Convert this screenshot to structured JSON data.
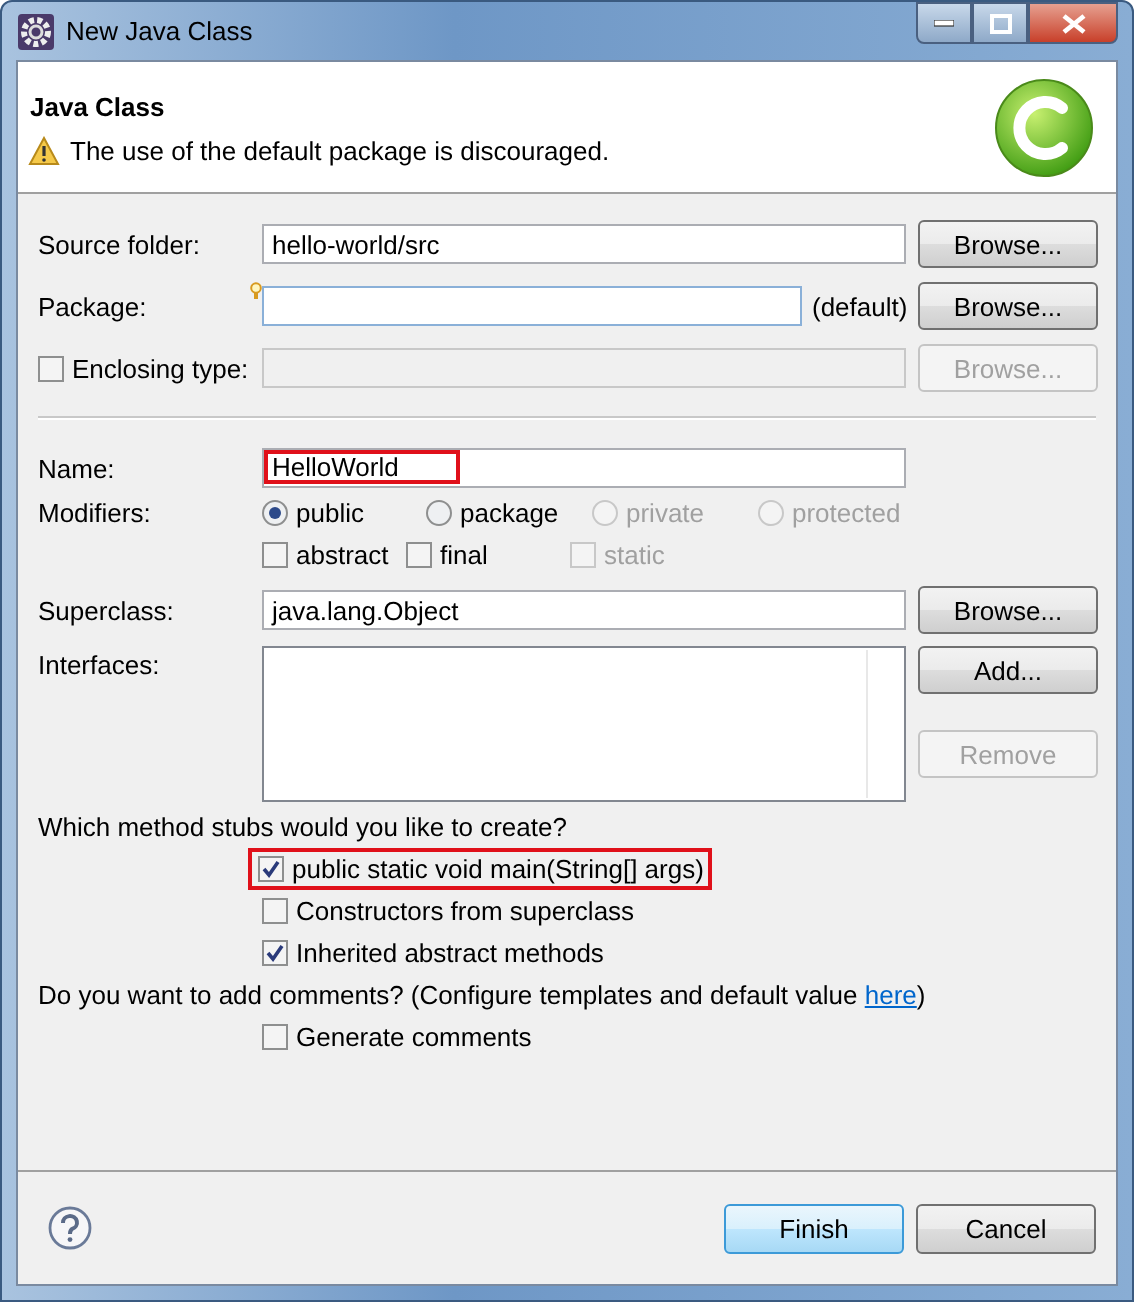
{
  "window": {
    "title": "New Java Class"
  },
  "header": {
    "title": "Java Class",
    "message": "The use of the default package is discouraged."
  },
  "source_folder": {
    "label": "Source folder:",
    "value": "hello-world/src",
    "button": {
      "label": "Browse...",
      "disabled": false
    }
  },
  "package": {
    "label": "Package:",
    "suffix": "(default)",
    "button": {
      "label": "Browse...",
      "disabled": false
    }
  },
  "enclosing_type": {
    "label": "Enclosing type:",
    "checked": false,
    "button": {
      "label": "Browse...",
      "disabled": true
    }
  },
  "name": {
    "label": "Name:",
    "value": "HelloWorld",
    "highlighted": true
  },
  "modifiers": {
    "label": "Modifiers:",
    "visibility": [
      {
        "label": "public",
        "selected": true,
        "disabled": false
      },
      {
        "label": "package",
        "selected": false,
        "disabled": false
      },
      {
        "label": "private",
        "selected": false,
        "disabled": true
      },
      {
        "label": "protected",
        "selected": false,
        "disabled": true
      }
    ],
    "flags": [
      {
        "label": "abstract",
        "checked": false,
        "disabled": false
      },
      {
        "label": "final",
        "checked": false,
        "disabled": false
      },
      {
        "label": "static",
        "checked": false,
        "disabled": true
      }
    ]
  },
  "superclass": {
    "label": "Superclass:",
    "value": "java.lang.Object",
    "button": {
      "label": "Browse...",
      "disabled": false
    }
  },
  "interfaces": {
    "label": "Interfaces:",
    "buttons": [
      {
        "label": "Add...",
        "disabled": false
      },
      {
        "label": "Remove",
        "disabled": true
      }
    ]
  },
  "stubs": {
    "question": "Which method stubs would you like to create?",
    "options": [
      {
        "label": "public static void main(String[] args)",
        "checked": true,
        "highlighted": true
      },
      {
        "label": "Constructors from superclass",
        "checked": false,
        "highlighted": false
      },
      {
        "label": "Inherited abstract methods",
        "checked": true,
        "highlighted": false
      }
    ]
  },
  "comments": {
    "question": "Do you want to add comments? (Configure templates and default value ",
    "link": "here",
    "closing": ")",
    "option": {
      "label": "Generate comments",
      "checked": false
    }
  },
  "footer": {
    "buttons": [
      {
        "label": "Finish",
        "default": true
      },
      {
        "label": "Cancel",
        "default": false
      }
    ]
  }
}
